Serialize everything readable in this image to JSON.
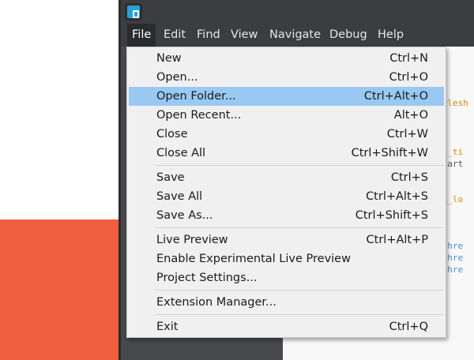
{
  "menubar": {
    "items": [
      {
        "label": "File"
      },
      {
        "label": "Edit"
      },
      {
        "label": "Find"
      },
      {
        "label": "View"
      },
      {
        "label": "Navigate"
      },
      {
        "label": "Debug"
      },
      {
        "label": "Help"
      }
    ]
  },
  "file_menu": {
    "items": [
      {
        "label": "New",
        "shortcut": "Ctrl+N"
      },
      {
        "label": "Open...",
        "shortcut": "Ctrl+O"
      },
      {
        "label": "Open Folder...",
        "shortcut": "Ctrl+Alt+O"
      },
      {
        "label": "Open Recent...",
        "shortcut": "Alt+O"
      },
      {
        "label": "Close",
        "shortcut": "Ctrl+W"
      },
      {
        "label": "Close All",
        "shortcut": "Ctrl+Shift+W"
      },
      {
        "label": "Save",
        "shortcut": "Ctrl+S"
      },
      {
        "label": "Save All",
        "shortcut": "Ctrl+Alt+S"
      },
      {
        "label": "Save As...",
        "shortcut": "Ctrl+Shift+S"
      },
      {
        "label": "Live Preview",
        "shortcut": "Ctrl+Alt+P"
      },
      {
        "label": "Enable Experimental Live Preview",
        "shortcut": ""
      },
      {
        "label": "Project Settings...",
        "shortcut": ""
      },
      {
        "label": "Extension Manager...",
        "shortcut": ""
      },
      {
        "label": "Exit",
        "shortcut": "Ctrl+Q"
      }
    ]
  },
  "editor": {
    "fragments": [
      "tylesh",
      "ex_ti",
      "Start",
      "ex_lo",
      "a hre",
      "a hre",
      "a hre"
    ]
  },
  "colors": {
    "accent_highlight": "#99c9f2",
    "desktop_orange": "#f05e40",
    "app_logo_blue": "#2a9fd8",
    "code_orange": "#d08a1a",
    "code_blue": "#4a8fd0"
  }
}
